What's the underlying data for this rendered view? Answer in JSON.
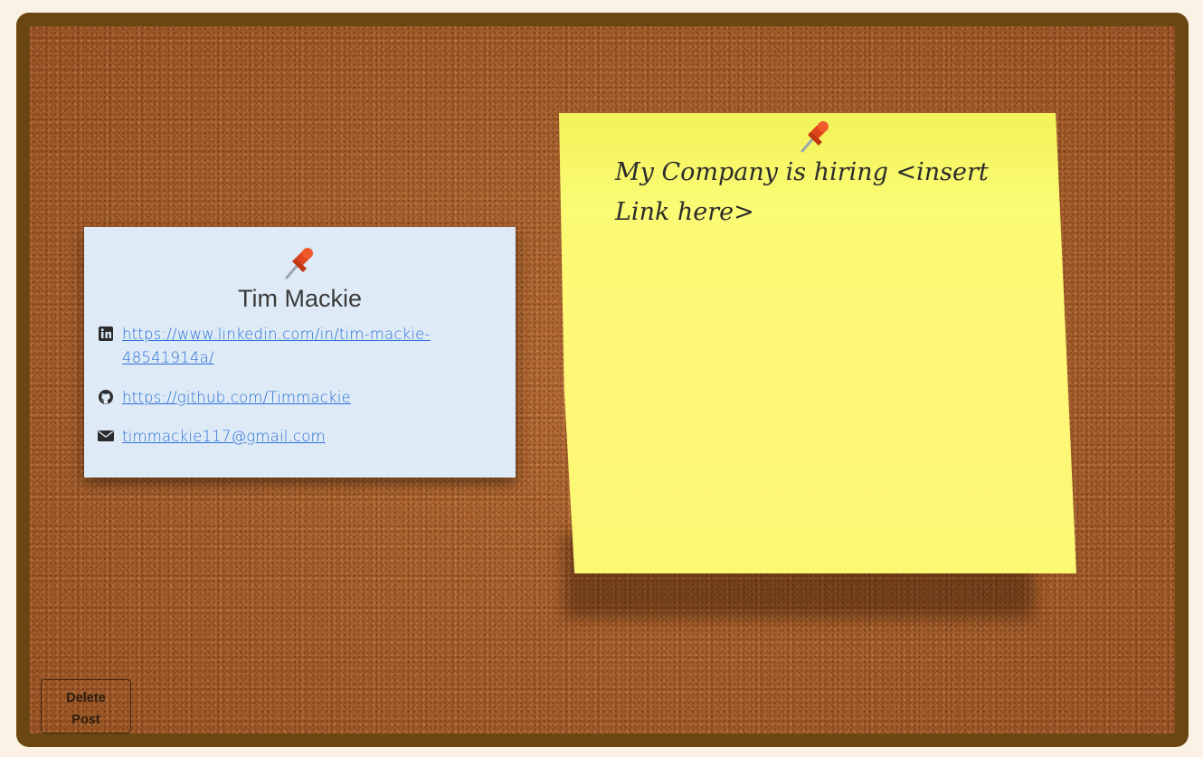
{
  "profile_card": {
    "name": "Tim Mackie",
    "links": {
      "linkedin_line1": "https://www.linkedin.com/in/tim-mackie-",
      "linkedin_line2": "48541914a/",
      "github": "https://github.com/Timmackie",
      "email": "timmackie117@gmail.com"
    },
    "icons": [
      "pushpin-icon",
      "linkedin-icon",
      "github-icon",
      "envelope-icon"
    ]
  },
  "sticky_note": {
    "text_line1": "My Company is hiring <insert",
    "text_line2": "Link here>"
  },
  "delete_button": {
    "label_line1": "Delete",
    "label_line2": "Post"
  },
  "colors": {
    "frame": "#6a4612",
    "cork": "#a8602e",
    "card": "#deebf7",
    "sticky": "#fbfb74",
    "link": "#2b6fd6"
  }
}
